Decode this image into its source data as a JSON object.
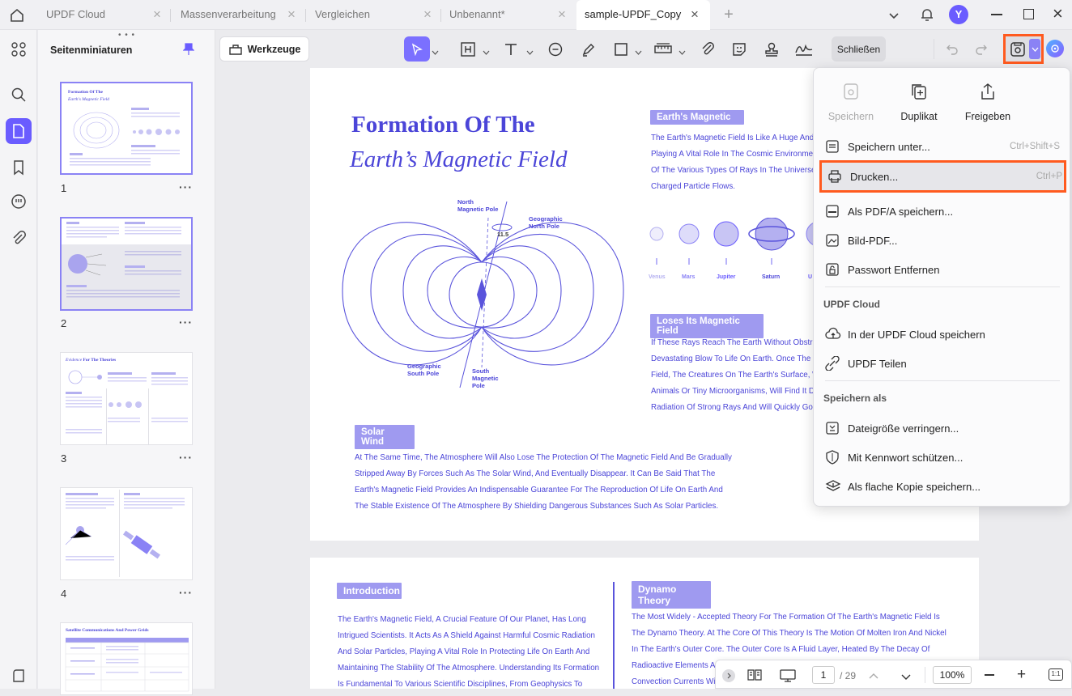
{
  "tabs": [
    {
      "label": "UPDF Cloud"
    },
    {
      "label": "Massenverarbeitung"
    },
    {
      "label": "Vergleichen"
    },
    {
      "label": "Unbenannt*"
    },
    {
      "label": "sample-UPDF_Copy"
    }
  ],
  "user": {
    "avatar_letter": "Y"
  },
  "panel": {
    "title": "Seitenminiaturen",
    "pages": [
      "1",
      "2",
      "3",
      "4"
    ]
  },
  "thumbnails": {
    "p1_title_line1": "Formation Of The",
    "p1_title_line2": "Earth's Magnetic Field",
    "p3_title_italic": "Evidence",
    "p3_title_rest": " For The Theories",
    "p5_title": "Satellite Communications And Power Grids"
  },
  "toolbar": {
    "tools_label": "Werkzeuge",
    "close_label": "Schließen"
  },
  "document": {
    "title_line1": "Formation Of The",
    "title_line2": "Earth’s Magnetic Field",
    "diagram_labels": {
      "north_magnetic": "North\nMagnetic Pole",
      "angle": "11.5",
      "geo_north": "Geographic\nNorth Pole",
      "geo_south": "Geographic\nSouth Pole",
      "south_magnetic": "South\nMagnetic\nPole"
    },
    "section_magnetic": {
      "heading": "Earth's Magnetic",
      "lines": [
        "The Earth's Magnetic Field Is Like A Huge And In",
        "Playing A Vital Role In The Cosmic Environment",
        "Of The Various Types Of Rays In The Universe,",
        "Charged Particle Flows."
      ]
    },
    "planets": [
      "Venus",
      "Mars",
      "Jupiter",
      "Saturn",
      "U"
    ],
    "section_loses": {
      "heading": "Loses Its Magnetic Field",
      "lines": [
        "If These Rays Reach The Earth Without Obstruc",
        "Devastating Blow To Life On Earth. Once The Ea",
        "Field, The Creatures On The Earth's Surface, W",
        "Animals Or Tiny Microorganisms, Will Find It Diff",
        "Radiation Of Strong Rays And Will Quickly Go T"
      ]
    },
    "section_solar": {
      "heading": "Solar Wind",
      "lines": [
        "At The Same Time, The Atmosphere Will Also Lose The Protection Of The Magnetic Field And Be Gradually",
        "Stripped Away By Forces Such As The Solar Wind, And Eventually Disappear. It Can Be Said That The",
        "Earth's Magnetic Field Provides An Indispensable Guarantee For The Reproduction Of Life On Earth And",
        "The Stable Existence Of The Atmosphere By Shielding Dangerous Substances Such As Solar Particles."
      ]
    },
    "section_intro": {
      "heading": "Introduction",
      "lines": [
        "The Earth's Magnetic Field, A Crucial Feature Of Our Planet, Has Long",
        "Intrigued Scientists. It Acts As A Shield Against Harmful Cosmic Radiation",
        "And Solar Particles, Playing A Vital Role In Protecting Life On Earth And",
        "Maintaining The Stability Of The Atmosphere. Understanding Its Formation",
        "Is Fundamental To Various Scientific Disciplines, From Geophysics To"
      ]
    },
    "section_dynamo": {
      "heading": "Dynamo Theory",
      "lines": [
        "The Most Widely - Accepted Theory For The Formation Of The Earth's Magnetic Field Is",
        "The Dynamo Theory. At The Core Of This Theory Is The Motion Of Molten Iron And Nickel",
        "In The Earth's Outer Core. The Outer Core Is A Fluid Layer, Heated By The Decay Of",
        "Radioactive Elements An",
        "Convection Currents Wit"
      ]
    }
  },
  "menu": {
    "top_actions": [
      {
        "label": "Speichern",
        "disabled": true
      },
      {
        "label": "Duplikat",
        "disabled": false
      },
      {
        "label": "Freigeben",
        "disabled": false
      }
    ],
    "items": [
      {
        "label": "Speichern unter...",
        "shortcut": "Ctrl+Shift+S"
      },
      {
        "label": "Drucken...",
        "shortcut": "Ctrl+P"
      },
      {
        "label": "Als PDF/A speichern..."
      },
      {
        "label": "Bild-PDF..."
      },
      {
        "label": "Passwort Entfernen"
      }
    ],
    "cloud_section": "UPDF Cloud",
    "cloud_items": [
      {
        "label": "In der UPDF Cloud speichern"
      },
      {
        "label": "UPDF Teilen"
      }
    ],
    "saveas_section": "Speichern als",
    "saveas_items": [
      {
        "label": "Dateigröße verringern..."
      },
      {
        "label": "Mit Kennwort schützen..."
      },
      {
        "label": "Als flache Kopie speichern..."
      }
    ]
  },
  "bottombar": {
    "page_current": "1",
    "page_total": "/ 29",
    "zoom": "100%"
  },
  "colors": {
    "accent": "#6a5cff",
    "doc_blue": "#4b45d8",
    "highlight": "#ff5a1f"
  }
}
